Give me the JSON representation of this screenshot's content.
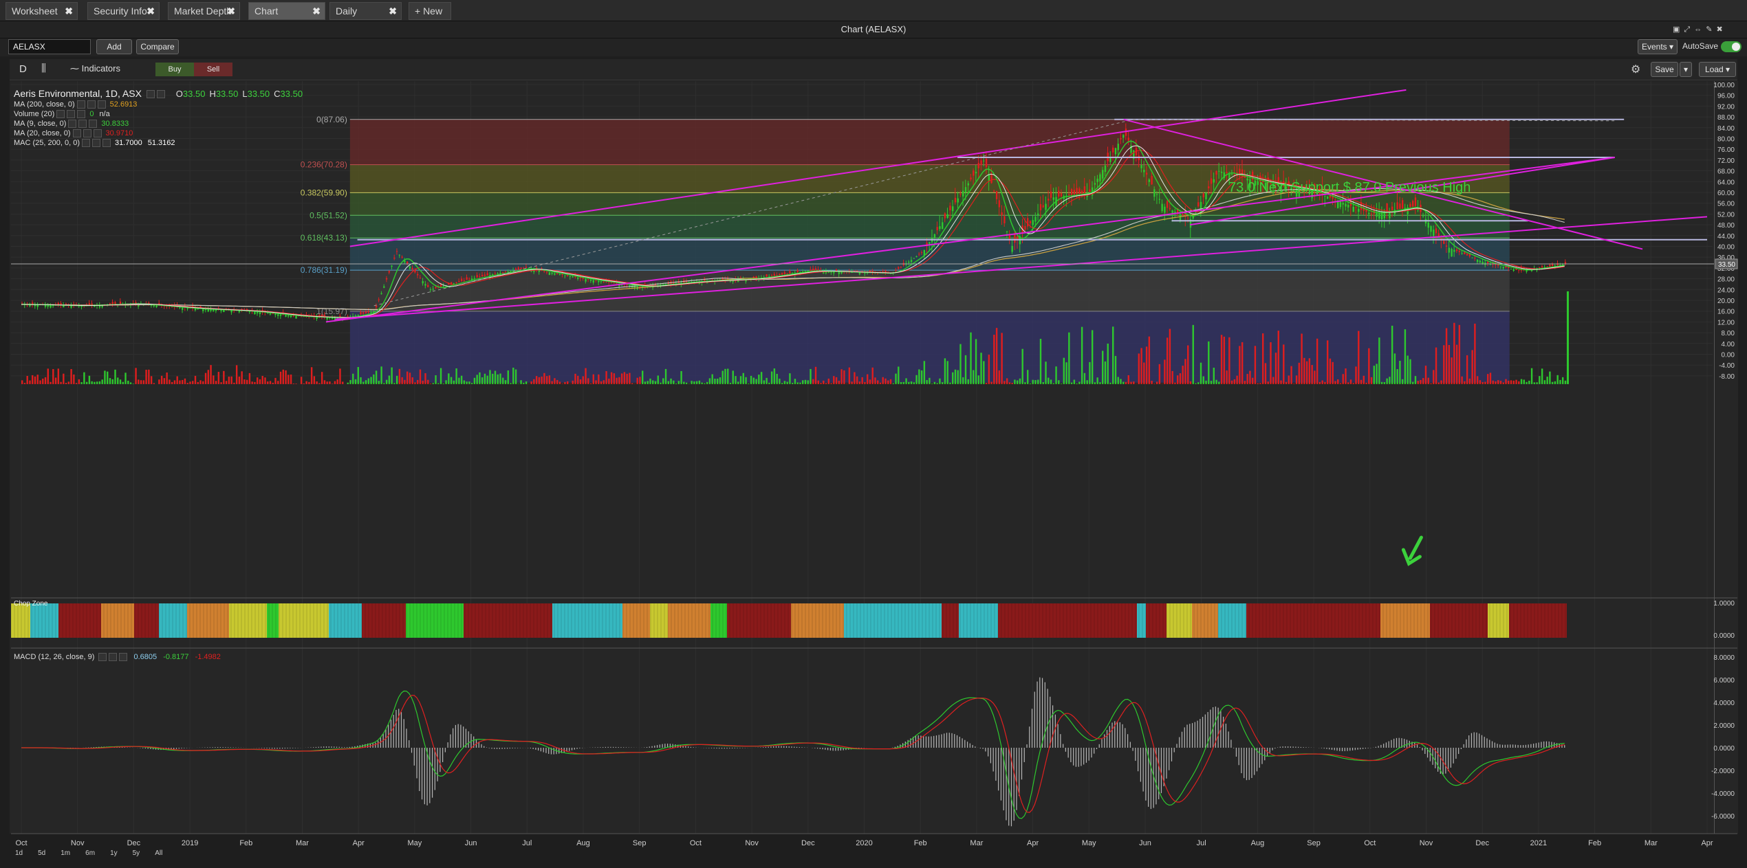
{
  "tabs": [
    {
      "label": "Worksheet"
    },
    {
      "label": "Security Info"
    },
    {
      "label": "Market Depth"
    },
    {
      "label": "Chart"
    },
    {
      "label": "Daily"
    }
  ],
  "tab_close_glyph": "✖",
  "new_tab_label": "+ New",
  "window_title": "Chart (AELASX)",
  "toolbar1": {
    "symbol": "AELASX",
    "add": "Add",
    "compare": "Compare",
    "events": "Events",
    "autosave": "AutoSave"
  },
  "toolbar2": {
    "interval": "D",
    "indicators": "Indicators",
    "buy": "Buy",
    "sell": "Sell",
    "save": "Save",
    "load": "Load"
  },
  "legend": {
    "title": "Aeris Environmental, 1D, ASX",
    "ohlc": [
      {
        "k": "O",
        "v": "33.50"
      },
      {
        "k": "H",
        "v": "33.50"
      },
      {
        "k": "L",
        "v": "33.50"
      },
      {
        "k": "C",
        "v": "33.50"
      }
    ],
    "rows": [
      {
        "label": "MA (200, close, 0)",
        "v1": "52.6913",
        "v2": "",
        "c1": "#e0a020",
        "c2": "#dddddd"
      },
      {
        "label": "Volume (20)",
        "v1": "0",
        "v2": "n/a",
        "c1": "#3cd13c",
        "c2": "#dddddd"
      },
      {
        "label": "MA (9, close, 0)",
        "v1": "30.8333",
        "v2": "",
        "c1": "#3cd13c",
        "c2": "#dddddd"
      },
      {
        "label": "MA (20, close, 0)",
        "v1": "30.9710",
        "v2": "",
        "c1": "#e02020",
        "c2": "#dddddd"
      },
      {
        "label": "MAC (25, 200, 0, 0)",
        "v1": "31.7000",
        "v2": "51.3162",
        "c1": "#ffffff",
        "c2": "#ffffff"
      }
    ]
  },
  "fib_labels": [
    {
      "label": "0(87.06)",
      "price": 87.06,
      "color": "#aaaaaa"
    },
    {
      "label": "0.236(70.28)",
      "price": 70.28,
      "color": "#c05050"
    },
    {
      "label": "0.382(59.90)",
      "price": 59.9,
      "color": "#c8c860"
    },
    {
      "label": "0.5(51.52)",
      "price": 51.52,
      "color": "#60c060"
    },
    {
      "label": "0.618(43.13)",
      "price": 43.13,
      "color": "#60c060"
    },
    {
      "label": "0.786(31.19)",
      "price": 31.19,
      "color": "#5aa0c8"
    },
    {
      "label": "1(15.97)",
      "price": 15.97,
      "color": "#888888"
    }
  ],
  "annotation": "73.0 Next Support $ 87.0 Previous High",
  "price_ticks": [
    "100.00",
    "96.00",
    "92.00",
    "88.00",
    "84.00",
    "80.00",
    "76.00",
    "72.00",
    "68.00",
    "64.00",
    "60.00",
    "56.00",
    "52.00",
    "48.00",
    "44.00",
    "40.00",
    "36.00",
    "32.00",
    "28.00",
    "24.00",
    "20.00",
    "16.00",
    "12.00",
    "8.00",
    "4.00",
    "0.00",
    "-4.00",
    "-8.00"
  ],
  "last_price": "33.50",
  "chop": {
    "label": "Chop Zone",
    "ticks": [
      "1.0000",
      "0.0000"
    ]
  },
  "macd": {
    "label": "MACD (12, 26, close, 9)",
    "v1": "0.6805",
    "v2": "-0.8177",
    "v3": "-1.4982",
    "ticks": [
      "8.0000",
      "6.0000",
      "4.0000",
      "2.0000",
      "0.0000",
      "-2.0000",
      "-4.0000",
      "-6.0000"
    ]
  },
  "time_labels": [
    "Oct",
    "Nov",
    "Dec",
    "2019",
    "Feb",
    "Mar",
    "Apr",
    "May",
    "Jun",
    "Jul",
    "Aug",
    "Sep",
    "Oct",
    "Nov",
    "Dec",
    "2020",
    "Feb",
    "Mar",
    "Apr",
    "May",
    "Jun",
    "Jul",
    "Aug",
    "Sep",
    "Oct",
    "Nov",
    "Dec",
    "2021",
    "Feb",
    "Mar",
    "Apr"
  ],
  "ranges": [
    "1d",
    "5d",
    "1m",
    "6m",
    "1y",
    "5y",
    "All"
  ],
  "colors": {
    "buy": "#3c5a2a",
    "sell": "#6a2a2a",
    "magenta": "#e020e0",
    "fib_line": "#b8b8e0"
  },
  "chart_data": {
    "type": "candlestick",
    "symbol": "AELASX",
    "interval": "1D",
    "ylim": [
      -8,
      100
    ],
    "x_range": [
      "2018-10",
      "2021-04"
    ],
    "last": {
      "open": 33.5,
      "high": 33.5,
      "low": 33.5,
      "close": 33.5
    },
    "close_path": [
      {
        "date": "2018-10-01",
        "close": 18.5
      },
      {
        "date": "2018-11-01",
        "close": 18.0
      },
      {
        "date": "2018-12-01",
        "close": 18.8
      },
      {
        "date": "2019-01-01",
        "close": 17.0
      },
      {
        "date": "2019-02-01",
        "close": 16.0
      },
      {
        "date": "2019-03-01",
        "close": 14.0
      },
      {
        "date": "2019-03-25",
        "close": 13.5
      },
      {
        "date": "2019-04-10",
        "close": 16.0
      },
      {
        "date": "2019-04-22",
        "close": 38.0
      },
      {
        "date": "2019-05-10",
        "close": 24.0
      },
      {
        "date": "2019-06-01",
        "close": 28.0
      },
      {
        "date": "2019-07-01",
        "close": 32.0
      },
      {
        "date": "2019-08-01",
        "close": 28.0
      },
      {
        "date": "2019-09-01",
        "close": 25.0
      },
      {
        "date": "2019-10-01",
        "close": 27.0
      },
      {
        "date": "2019-11-01",
        "close": 28.0
      },
      {
        "date": "2019-12-01",
        "close": 31.0
      },
      {
        "date": "2020-01-15",
        "close": 30.0
      },
      {
        "date": "2020-02-01",
        "close": 38.0
      },
      {
        "date": "2020-02-20",
        "close": 58.0
      },
      {
        "date": "2020-03-05",
        "close": 72.0
      },
      {
        "date": "2020-03-20",
        "close": 40.0
      },
      {
        "date": "2020-04-10",
        "close": 58.0
      },
      {
        "date": "2020-05-01",
        "close": 60.0
      },
      {
        "date": "2020-05-20",
        "close": 82.0
      },
      {
        "date": "2020-06-10",
        "close": 55.0
      },
      {
        "date": "2020-06-25",
        "close": 50.0
      },
      {
        "date": "2020-07-10",
        "close": 68.0
      },
      {
        "date": "2020-08-01",
        "close": 64.0
      },
      {
        "date": "2020-09-01",
        "close": 60.0
      },
      {
        "date": "2020-10-01",
        "close": 52.0
      },
      {
        "date": "2020-10-25",
        "close": 55.0
      },
      {
        "date": "2020-11-10",
        "close": 40.0
      },
      {
        "date": "2020-12-01",
        "close": 34.0
      },
      {
        "date": "2020-12-20",
        "close": 31.0
      },
      {
        "date": "2021-01-15",
        "close": 33.5
      }
    ],
    "fibonacci": {
      "high": 87.06,
      "low": 15.97,
      "levels": [
        0,
        0.236,
        0.382,
        0.5,
        0.618,
        0.786,
        1
      ]
    },
    "horizontal_levels": [
      87.06,
      73.0,
      49.5,
      42.5
    ],
    "trendlines": [
      {
        "from": {
          "date": "2019-03-28",
          "price": 40
        },
        "to": {
          "date": "2020-10-20",
          "price": 98
        }
      },
      {
        "from": {
          "date": "2019-03-15",
          "price": 12
        },
        "to": {
          "date": "2021-02-10",
          "price": 73
        }
      },
      {
        "from": {
          "date": "2019-03-20",
          "price": 13
        },
        "to": {
          "date": "2021-04-01",
          "price": 51
        }
      },
      {
        "from": {
          "date": "2020-05-20",
          "price": 87.06
        },
        "to": {
          "date": "2021-02-25",
          "price": 39
        }
      }
    ]
  }
}
